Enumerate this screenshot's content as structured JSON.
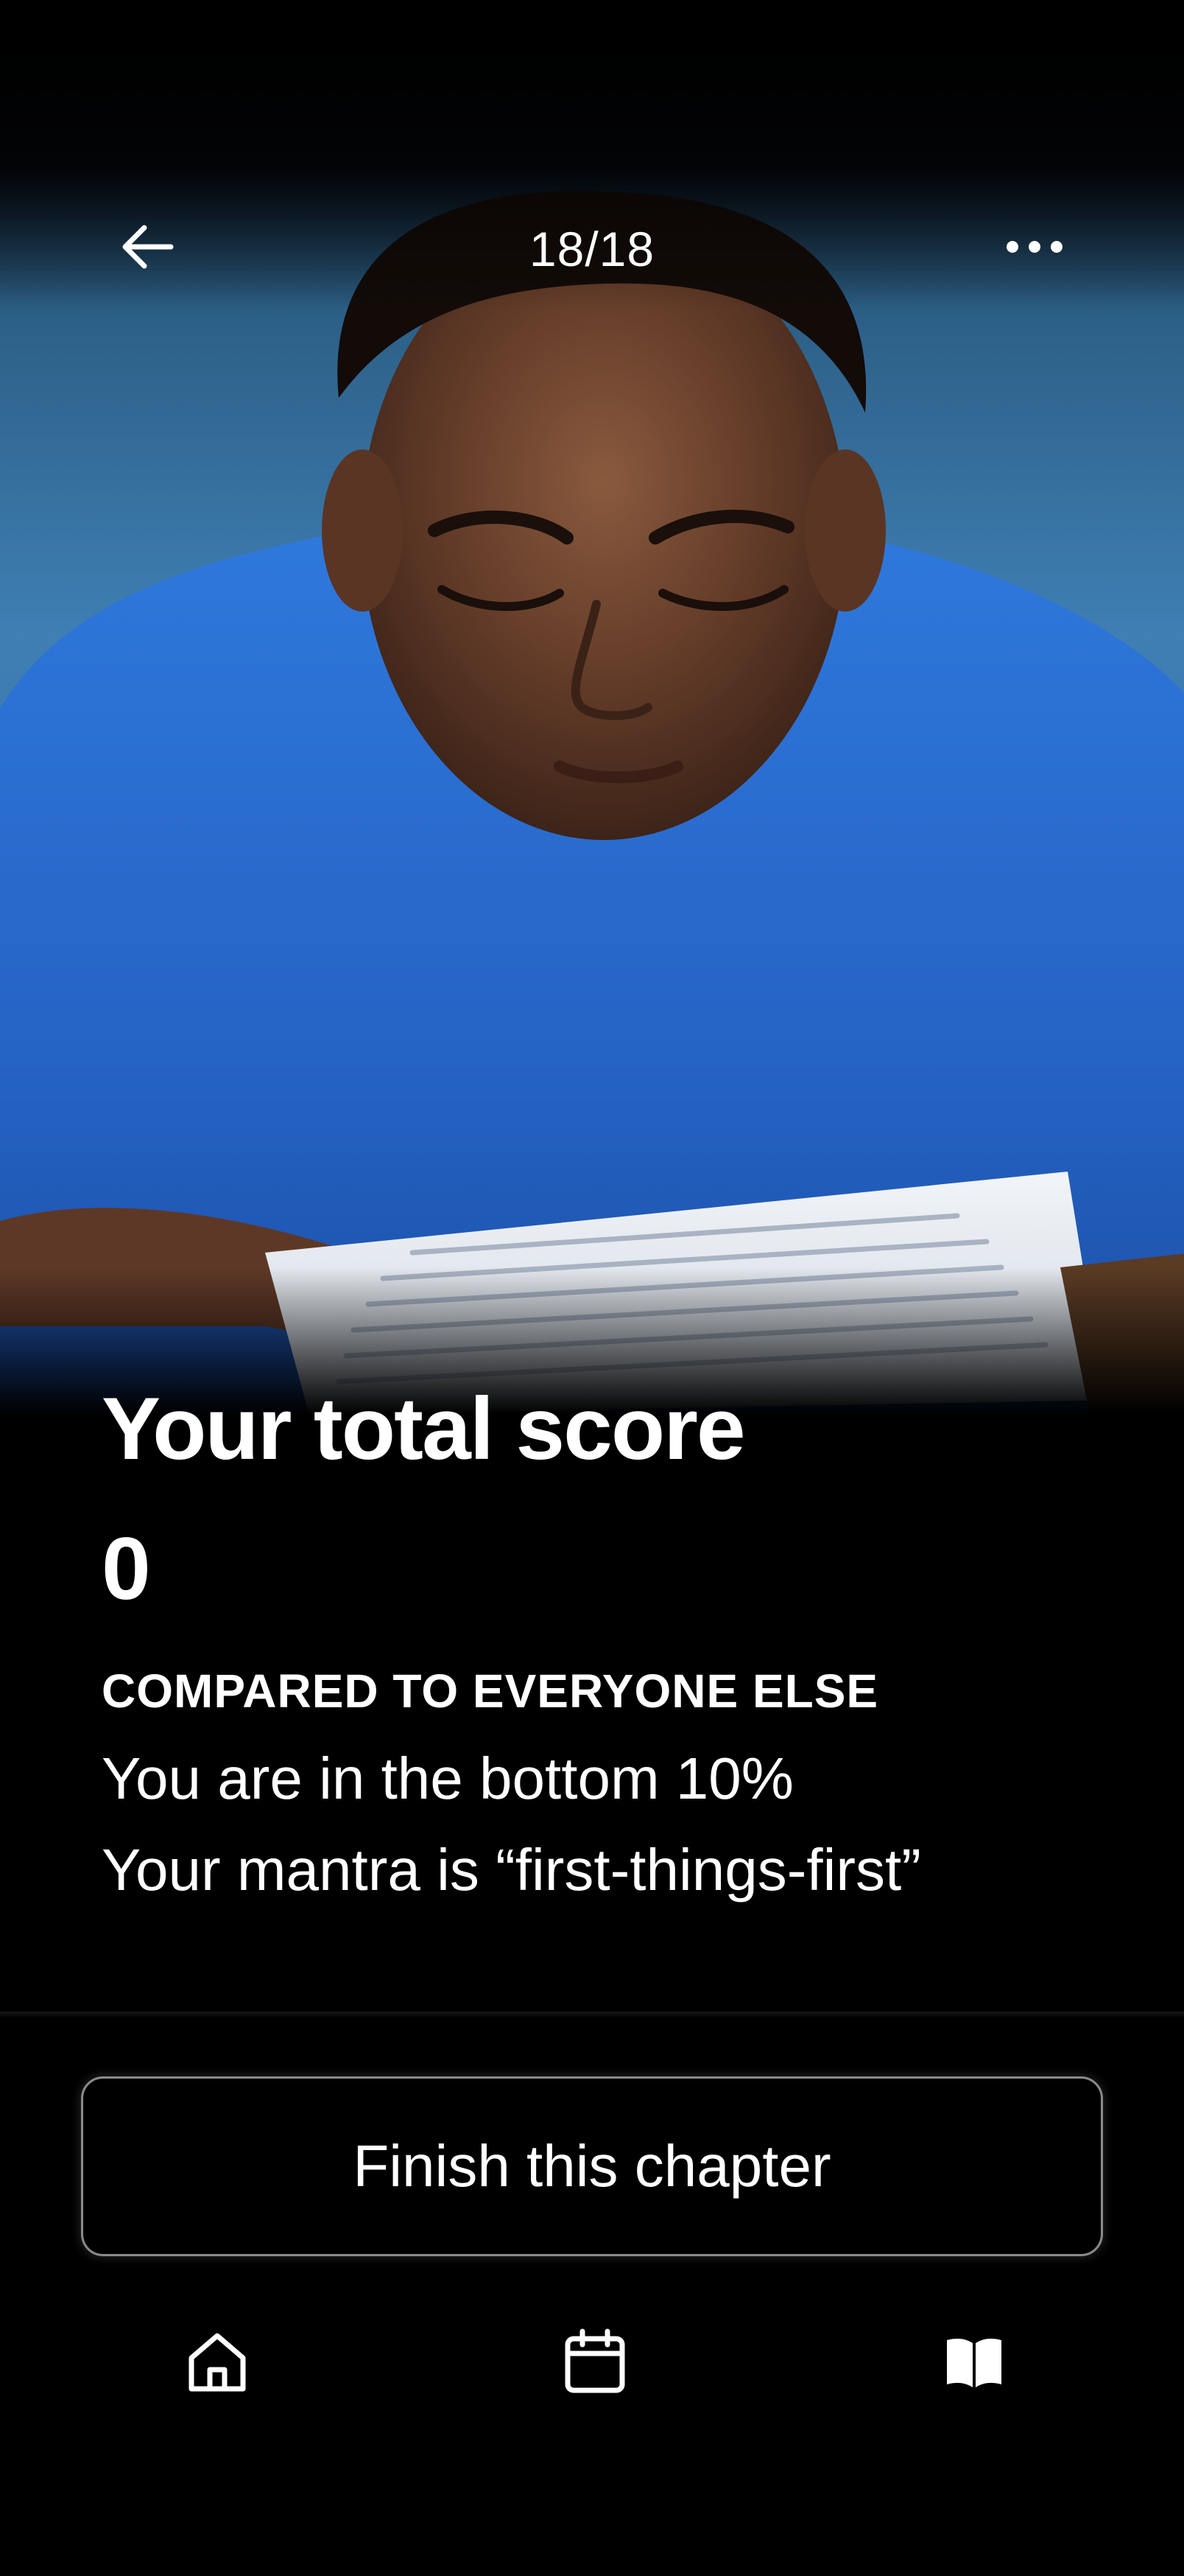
{
  "header": {
    "progress": "18/18",
    "back_icon": "arrow-left-icon",
    "more_icon": "more-horizontal-icon"
  },
  "hero": {
    "image": "student-reading-paper-photo"
  },
  "score": {
    "title": "Your total score",
    "value": "0",
    "compare_label": "COMPARED TO EVERYONE ELSE",
    "percentile_text": "You are in the bottom 10%",
    "mantra_text": "Your mantra is “first-things-first”"
  },
  "actions": {
    "finish_label": "Finish this chapter"
  },
  "nav": {
    "items": [
      {
        "icon": "home-icon"
      },
      {
        "icon": "calendar-icon"
      },
      {
        "icon": "book-icon"
      }
    ]
  },
  "colors": {
    "background": "#000000",
    "text": "#ffffff",
    "button_border": "#8a8a8a",
    "sweater_blue": "#2a6fd4"
  }
}
